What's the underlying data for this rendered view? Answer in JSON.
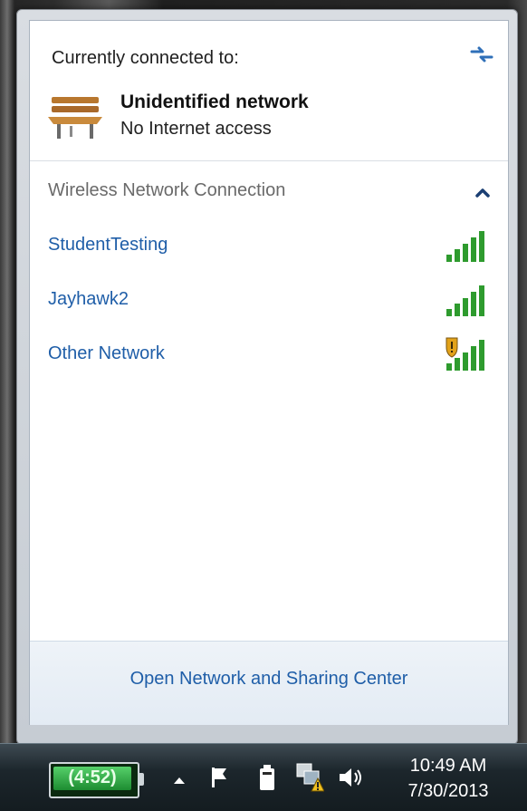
{
  "flyout": {
    "header_title": "Currently connected to:",
    "current_network": {
      "name": "Unidentified network",
      "status": "No Internet access"
    },
    "section_title": "Wireless Network Connection",
    "networks": [
      {
        "label": "StudentTesting",
        "signal_bars": 5,
        "secured_warning": false
      },
      {
        "label": "Jayhawk2",
        "signal_bars": 5,
        "secured_warning": false
      },
      {
        "label": "Other Network",
        "signal_bars": 5,
        "secured_warning": true
      }
    ],
    "footer_link": "Open Network and Sharing Center"
  },
  "taskbar": {
    "battery_time": "(4:52)",
    "clock_time": "10:49 AM",
    "clock_date": "7/30/2013"
  },
  "icons": {
    "refresh": "refresh-arrows-icon",
    "current_network": "park-bench-icon",
    "collapse": "chevron-up-icon",
    "signal": "signal-strength-icon",
    "shield": "security-shield-icon"
  },
  "colors": {
    "link": "#1f5ea8",
    "signal_green": "#2e9b2e",
    "section_gray": "#6a6a6a"
  }
}
